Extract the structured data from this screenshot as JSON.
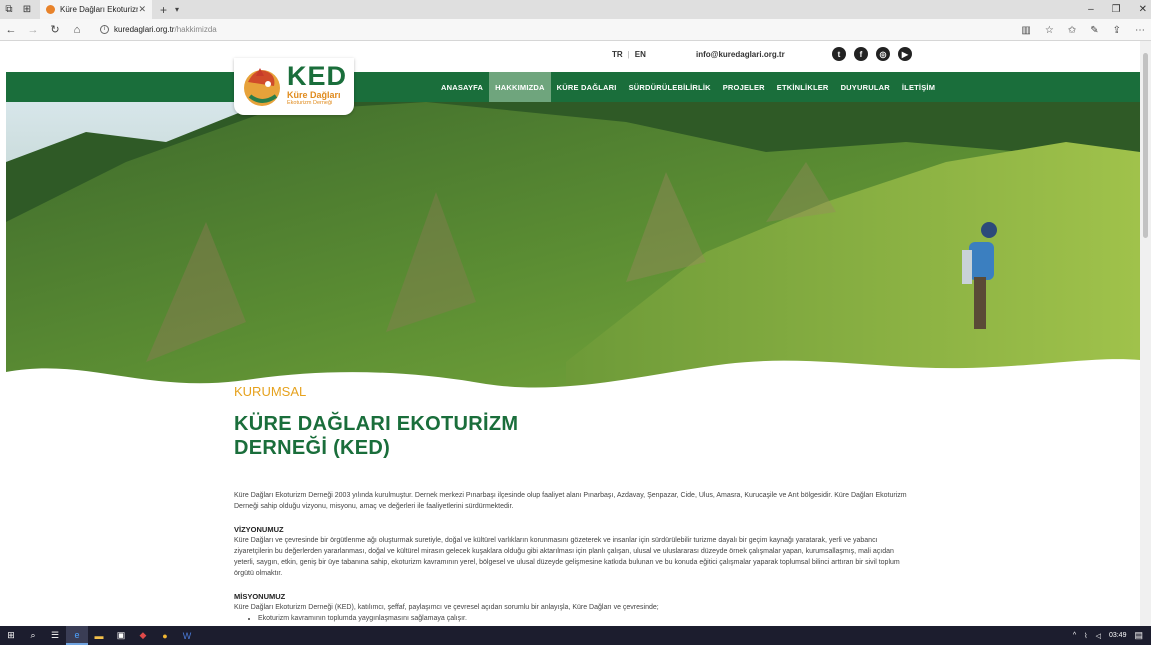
{
  "browser": {
    "tab_title": "Küre Dağları Ekoturizm",
    "url_host": "kuredaglari.org.tr",
    "url_path": "/hakkimizda"
  },
  "site": {
    "lang_tr": "TR",
    "lang_en": "EN",
    "email": "info@kuredaglari.org.tr",
    "logo_title": "KED",
    "logo_sub1": "Küre Dağları",
    "logo_sub2": "Ekoturizm Derneği",
    "nav": [
      {
        "label": "ANASAYFA",
        "active": false
      },
      {
        "label": "HAKKIMIZDA",
        "active": true
      },
      {
        "label": "KÜRE DAĞLARI",
        "active": false
      },
      {
        "label": "SÜRDÜRÜLEBİLİRLİK",
        "active": false
      },
      {
        "label": "PROJELER",
        "active": false
      },
      {
        "label": "ETKİNLİKLER",
        "active": false
      },
      {
        "label": "DUYURULAR",
        "active": false
      },
      {
        "label": "İLETİŞİM",
        "active": false
      }
    ]
  },
  "page": {
    "kicker": "KURUMSAL",
    "title_line1": "KÜRE DAĞLARI EKOTURİZM",
    "title_line2": "DERNEĞİ (KED)",
    "intro": "Küre Dağları Ekoturizm Derneği 2003 yılında kurulmuştur. Dernek merkezi Pınarbaşı ilçesinde olup faaliyet alanı Pınarbaşı, Azdavay, Şenpazar, Cide, Ulus, Amasra, Kurucaşile ve Arıt bölgesidir. Küre Dağları Ekoturizm Derneği sahip olduğu vizyonu, misyonu, amaç ve değerleri ile faaliyetlerini sürdürmektedir.",
    "vision_heading": "VİZYONUMUZ",
    "vision_text": "Küre Dağları ve çevresinde bir örgütlenme ağı oluşturmak suretiyle, doğal ve kültürel varlıkların korunmasını gözeterek ve insanlar için sürdürülebilir turizme dayalı bir geçim kaynağı yaratarak, yerli ve yabancı ziyaretçilerin bu değerlerden yararlanması, doğal ve kültürel mirasın gelecek kuşaklara olduğu gibi aktarılması için planlı çalışan, ulusal ve uluslararası düzeyde örnek çalışmalar yapan, kurumsallaşmış, mali açıdan yeterli, saygın, etkin, geniş bir üye tabanına sahip, ekoturizm kavramının yerel, bölgesel ve ulusal düzeyde gelişmesine katkıda bulunan ve bu konuda eğitici çalışmalar yaparak toplumsal bilinci arttıran bir sivil toplum örgütü olmaktır.",
    "mission_heading": "MİSYONUMUZ",
    "mission_text": "Küre Dağları Ekoturizm Derneği (KED), katılımcı, şeffaf, paylaşımcı ve çevresel açıdan sorumlu bir anlayışla, Küre Dağları ve çevresinde;",
    "mission_item1": "Ekoturizm kavramının toplumda yaygınlaşmasını sağlamaya çalışır."
  },
  "taskbar": {
    "time": "03:49"
  },
  "colors": {
    "brand_green": "#1a6e3b",
    "active_nav": "#6fa57d",
    "accent_orange": "#e6a21e"
  }
}
